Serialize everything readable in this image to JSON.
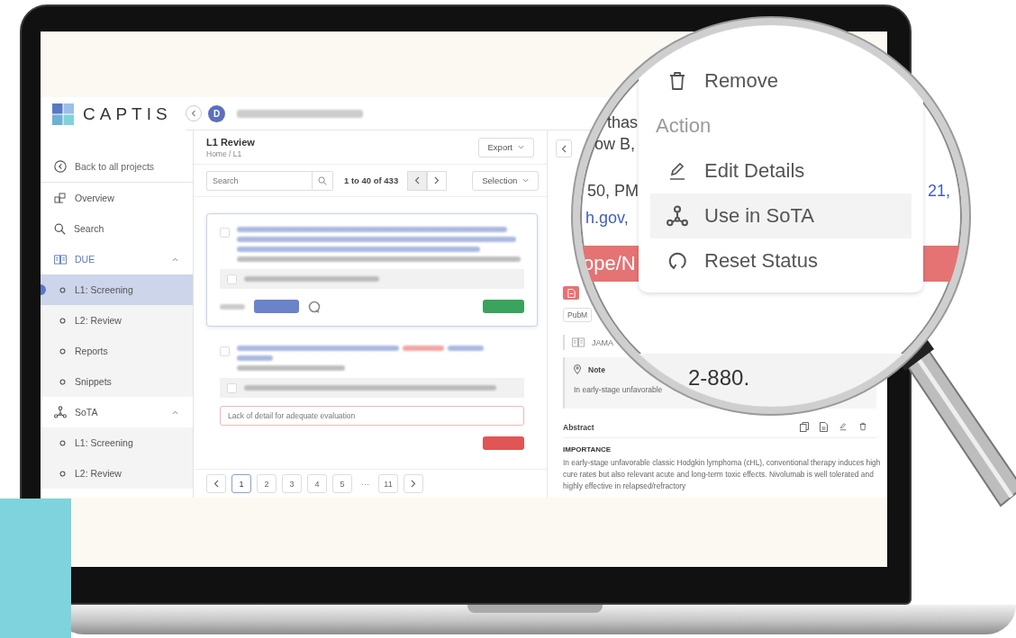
{
  "sidebar": {
    "logo": "CAPTIS",
    "back_link": "Back to all projects",
    "items": [
      {
        "kind": "link",
        "label": "Overview",
        "selected": false
      },
      {
        "kind": "link",
        "label": "Search",
        "selected": false
      },
      {
        "kind": "section",
        "label": "DUE",
        "selected": true,
        "expanded": true,
        "children": [
          {
            "label": "L1: Screening",
            "selected": true
          },
          {
            "label": "L2: Review",
            "selected": false
          },
          {
            "label": "Reports",
            "selected": false
          },
          {
            "label": "Snippets",
            "selected": false
          }
        ]
      },
      {
        "kind": "section",
        "label": "SoTA",
        "selected": false,
        "expanded": true,
        "children": [
          {
            "label": "L1: Screening",
            "selected": false
          },
          {
            "label": "L2: Review",
            "selected": false
          }
        ]
      }
    ]
  },
  "topbar": {
    "user_initial": "D"
  },
  "list_panel": {
    "title": "L1 Review",
    "breadcrumb": "Home / L1",
    "export_button": "Export",
    "search": {
      "placeholder": "Search"
    },
    "range": "1 to 40 of 433",
    "selection_button": "Selection",
    "cards": [
      {
        "selected": true,
        "color": "#3aa35d"
      },
      {
        "selected": false,
        "color": "#e05555",
        "comment": "Lack of detail for adequate evaluation"
      }
    ],
    "pages": [
      {
        "kind": "page",
        "label": "1",
        "selected": true
      },
      {
        "kind": "page",
        "label": "2",
        "selected": false
      },
      {
        "kind": "page",
        "label": "3",
        "selected": false
      },
      {
        "kind": "page",
        "label": "4",
        "selected": false
      },
      {
        "kind": "page",
        "label": "5",
        "selected": false
      },
      {
        "kind": "ellipsis",
        "label": "···"
      },
      {
        "kind": "page",
        "label": "11",
        "selected": false
      }
    ]
  },
  "detail_panel": {
    "source_tag": "PubM",
    "journal": "JAMA",
    "note": {
      "label": "Note",
      "text": "In early-stage unfavorable"
    },
    "abstract": {
      "label": "Abstract",
      "heading": "IMPORTANCE",
      "text": "In early-stage unfavorable classic Hodgkin lymphoma (cHL), conventional therapy induces high cure rates but also relevant acute and long-term toxic effects. Nivolumab is well tolerated and highly effective in relapsed/refractory"
    }
  },
  "magnifier": {
    "fragments": [
      {
        "kind": "text",
        "text": "thas"
      },
      {
        "kind": "text",
        "text": "ow B,"
      },
      {
        "kind": "text",
        "text": "50, PM"
      },
      {
        "kind": "link",
        "text": "21,"
      },
      {
        "kind": "link",
        "text": "h.gov,"
      },
      {
        "kind": "banner",
        "text": "ope/N"
      },
      {
        "kind": "text",
        "text": "2-880."
      }
    ],
    "menu": [
      {
        "kind": "item",
        "label": "Remove",
        "selected": false
      },
      {
        "kind": "header",
        "label": "Action"
      },
      {
        "kind": "item",
        "label": "Edit Details",
        "selected": false
      },
      {
        "kind": "item",
        "label": "Use in SoTA",
        "selected": true
      },
      {
        "kind": "item",
        "label": "Reset Status",
        "selected": false
      }
    ]
  }
}
